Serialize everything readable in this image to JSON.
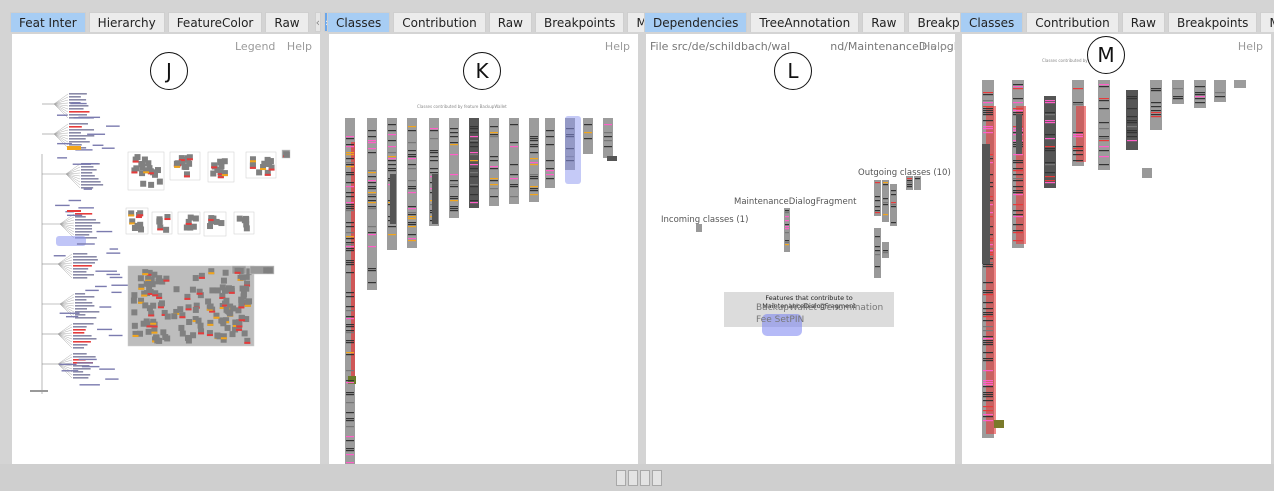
{
  "panes": [
    {
      "id": "J",
      "tabs": [
        {
          "label": "Feat Inter",
          "active": true
        },
        {
          "label": "Hierarchy",
          "active": false
        },
        {
          "label": "FeatureColor",
          "active": false
        },
        {
          "label": "Raw",
          "active": false
        }
      ],
      "arrows": [
        "‹",
        "›"
      ],
      "links": [
        "Legend",
        "Help"
      ],
      "marker": "J"
    },
    {
      "id": "K",
      "tabs": [
        {
          "label": "Classes",
          "active": true
        },
        {
          "label": "Contribution",
          "active": false
        },
        {
          "label": "Raw",
          "active": false
        },
        {
          "label": "Breakpoints",
          "active": false
        },
        {
          "label": "Meta",
          "active": false
        }
      ],
      "links": [
        "Help"
      ],
      "marker": "K",
      "caption": "Classes contributed by feature BackupWallet"
    },
    {
      "id": "L",
      "tabs": [
        {
          "label": "Dependencies",
          "active": true
        },
        {
          "label": "TreeAnnotation",
          "active": false
        },
        {
          "label": "Raw",
          "active": false
        },
        {
          "label": "Breakpoints",
          "active": false
        }
      ],
      "arrows": [
        "‹",
        "›"
      ],
      "file_path": "File src/de/schildbach/wal",
      "file_path_tail": "nd/MaintenanceDialogFragme",
      "links": [
        "Help"
      ],
      "marker": "L",
      "outgoing_label": "Outgoing classes (10)",
      "center_label": "MaintenanceDialogFragment",
      "incoming_label": "Incoming classes (1)",
      "features_title": "Features that contribute to MaintenanceDialogFragment",
      "features": [
        "BackupWallet Denomination",
        "Fee SetPIN"
      ]
    },
    {
      "id": "M",
      "tabs": [
        {
          "label": "Classes",
          "active": true
        },
        {
          "label": "Contribution",
          "active": false
        },
        {
          "label": "Raw",
          "active": false
        },
        {
          "label": "Breakpoints",
          "active": false
        },
        {
          "label": "Meta",
          "active": false
        }
      ],
      "links": [
        "Help"
      ],
      "marker": "M",
      "caption": "Classes contributed by feature SetPIN"
    }
  ],
  "colors": {
    "tab_active": "#a7cdf4",
    "highlight": "#8c96f0",
    "bar_gray": "#9c9c9c",
    "bar_dark": "#555555",
    "red": "#e63b3b",
    "pink": "#ff5fc8",
    "orange": "#f2a51c"
  }
}
